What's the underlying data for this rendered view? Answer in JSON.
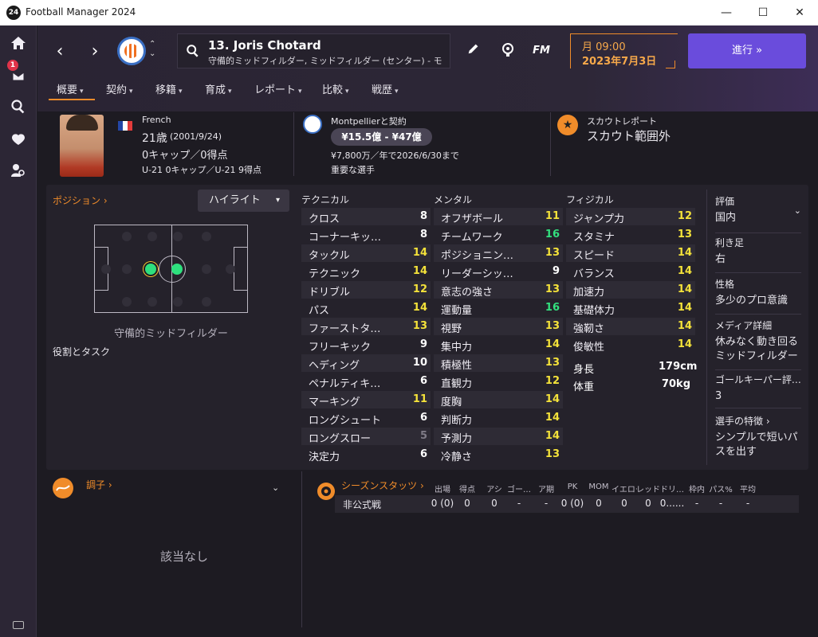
{
  "window": {
    "title": "Football Manager 2024",
    "icon_text": "24"
  },
  "rail": {
    "badge": "1"
  },
  "header": {
    "player_title": "13. Joris Chotard",
    "player_sub": "守備的ミッドフィルダー, ミッドフィルダー (センター) - モンペリエ",
    "time": "月 09:00",
    "date": "2023年7月3日",
    "continue_label": "進行 »",
    "fm_logo": "FM"
  },
  "tabs": [
    "概要",
    "契約",
    "移籍",
    "育成",
    "レポート",
    "比較",
    "戦歴"
  ],
  "overview": {
    "nationality": "French",
    "age": "21歳",
    "birth": "(2001/9/24)",
    "caps": "0キャップ／0得点",
    "u21": "U-21 0キャップ／U-21 9得点",
    "contract_title": "Montpellierと契約",
    "value": "¥15.5億 - ¥47億",
    "wage": "¥7,800万／年で2026/6/30まで",
    "squad_status": "重要な選手",
    "scout_label": "スカウトレポート",
    "scout_value": "スカウト範囲外"
  },
  "position": {
    "title": "ポジション ›",
    "highlight": "ハイライト",
    "name": "守備的ミッドフィルダー",
    "role_label": "役割とタスク"
  },
  "attributes": {
    "technical_title": "テクニカル",
    "mental_title": "メンタル",
    "physical_title": "フィジカル",
    "technical": [
      {
        "name": "クロス",
        "value": "8",
        "tone": "w"
      },
      {
        "name": "コーナーキッ…",
        "value": "8",
        "tone": "w"
      },
      {
        "name": "タックル",
        "value": "14",
        "tone": "y"
      },
      {
        "name": "テクニック",
        "value": "14",
        "tone": "y"
      },
      {
        "name": "ドリブル",
        "value": "12",
        "tone": "y"
      },
      {
        "name": "パス",
        "value": "14",
        "tone": "y"
      },
      {
        "name": "ファーストタ…",
        "value": "13",
        "tone": "y"
      },
      {
        "name": "フリーキック",
        "value": "9",
        "tone": "w"
      },
      {
        "name": "ヘディング",
        "value": "10",
        "tone": "w"
      },
      {
        "name": "ペナルティキ…",
        "value": "6",
        "tone": "w"
      },
      {
        "name": "マーキング",
        "value": "11",
        "tone": "y"
      },
      {
        "name": "ロングシュート",
        "value": "6",
        "tone": "w"
      },
      {
        "name": "ロングスロー",
        "value": "5",
        "tone": "d"
      },
      {
        "name": "決定力",
        "value": "6",
        "tone": "w"
      }
    ],
    "mental": [
      {
        "name": "オフザボール",
        "value": "11",
        "tone": "y"
      },
      {
        "name": "チームワーク",
        "value": "16",
        "tone": "g"
      },
      {
        "name": "ポジショニン…",
        "value": "13",
        "tone": "y"
      },
      {
        "name": "リーダーシッ…",
        "value": "9",
        "tone": "w"
      },
      {
        "name": "意志の強さ",
        "value": "13",
        "tone": "y"
      },
      {
        "name": "運動量",
        "value": "16",
        "tone": "g"
      },
      {
        "name": "視野",
        "value": "13",
        "tone": "y"
      },
      {
        "name": "集中力",
        "value": "14",
        "tone": "y"
      },
      {
        "name": "積極性",
        "value": "13",
        "tone": "y"
      },
      {
        "name": "直観力",
        "value": "12",
        "tone": "y"
      },
      {
        "name": "度胸",
        "value": "14",
        "tone": "y"
      },
      {
        "name": "判断力",
        "value": "14",
        "tone": "y"
      },
      {
        "name": "予測力",
        "value": "14",
        "tone": "y"
      },
      {
        "name": "冷静さ",
        "value": "13",
        "tone": "y"
      }
    ],
    "physical": [
      {
        "name": "ジャンプ力",
        "value": "12",
        "tone": "y"
      },
      {
        "name": "スタミナ",
        "value": "13",
        "tone": "y"
      },
      {
        "name": "スピード",
        "value": "14",
        "tone": "y"
      },
      {
        "name": "バランス",
        "value": "14",
        "tone": "y"
      },
      {
        "name": "加速力",
        "value": "14",
        "tone": "y"
      },
      {
        "name": "基礎体力",
        "value": "14",
        "tone": "y"
      },
      {
        "name": "強靭さ",
        "value": "14",
        "tone": "y"
      },
      {
        "name": "俊敏性",
        "value": "14",
        "tone": "y"
      }
    ],
    "height_label": "身長",
    "height": "179cm",
    "weight_label": "体重",
    "weight": "70kg"
  },
  "info": [
    {
      "label": "評価",
      "value": "国内"
    },
    {
      "label": "利き足",
      "value": "右"
    },
    {
      "label": "性格",
      "value": "多少のプロ意識"
    },
    {
      "label": "メディア詳細",
      "value": "休みなく動き回るミッドフィルダー"
    },
    {
      "label": "ゴールキーパー評…",
      "value": "3"
    },
    {
      "label": "選手の特徴 ›",
      "value": "シンプルで短いパスを出す"
    }
  ],
  "form": {
    "title": "調子 ›",
    "empty": "該当なし"
  },
  "stats": {
    "title": "シーズンスタッツ ›",
    "headers": [
      "出場",
      "得点",
      "アシ",
      "ゴー…",
      "ア期",
      "PK",
      "MOM",
      "イエロー",
      "レッド",
      "ドリ…",
      "枠内",
      "パス%",
      "平均"
    ],
    "row_label": "非公式戦",
    "row_values": [
      "0 (0)",
      "0",
      "0",
      "-",
      "-",
      "0 (0)",
      "0",
      "0",
      "0",
      "0......",
      "-",
      "-",
      "-"
    ]
  }
}
